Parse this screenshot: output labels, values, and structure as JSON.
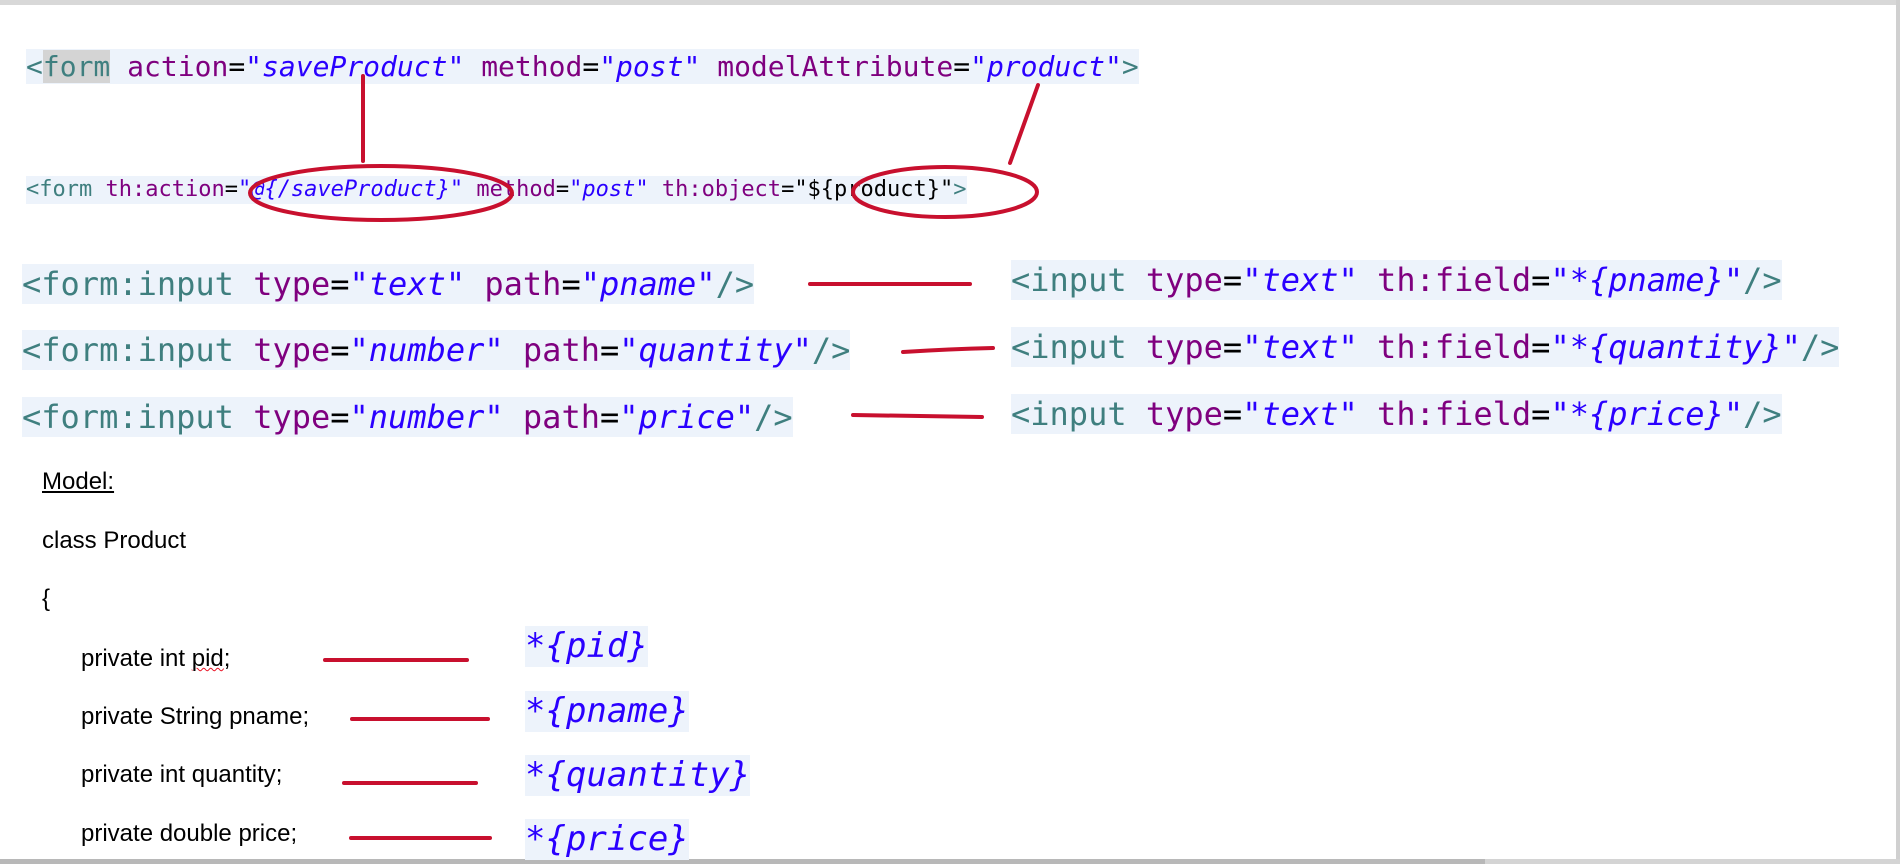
{
  "spring_form": {
    "open": "<",
    "tag": "form",
    "action_attr": "action",
    "action_value": "\"saveProduct\"",
    "method_attr": "method",
    "method_value": "\"post\"",
    "model_attr": "modelAttribute",
    "model_value": "\"product\"",
    "close": ">"
  },
  "thymeleaf_form": {
    "open": "<form",
    "action_attr": "th:action",
    "action_value": "\"@{/saveProduct}\"",
    "method_attr": "method",
    "method_value": "\"post\"",
    "object_attr": "th:object",
    "object_value": "\"${product}\"",
    "close": ">"
  },
  "spring_inputs": [
    {
      "tag": "<form:input",
      "type_attr": "type",
      "type_value": "\"text\"",
      "path_attr": "path",
      "path_value": "\"pname\"",
      "end": "/>"
    },
    {
      "tag": "<form:input",
      "type_attr": "type",
      "type_value": "\"number\"",
      "path_attr": "path",
      "path_value": "\"quantity\"",
      "end": "/>"
    },
    {
      "tag": "<form:input",
      "type_attr": "type",
      "type_value": "\"number\"",
      "path_attr": "path",
      "path_value": "\"price\"",
      "end": "/>"
    }
  ],
  "thymeleaf_inputs": [
    {
      "tag": "<input",
      "type_attr": "type",
      "type_value": "\"text\"",
      "field_attr": "th:field",
      "field_value": "\"*{pname}\"",
      "end": "/>"
    },
    {
      "tag": "<input",
      "type_attr": "type",
      "type_value": "\"text\"",
      "field_attr": "th:field",
      "field_value": "\"*{quantity}\"",
      "end": "/>"
    },
    {
      "tag": "<input",
      "type_attr": "type",
      "type_value": "\"text\"",
      "field_attr": "th:field",
      "field_value": "\"*{price}\"",
      "end": "/>"
    }
  ],
  "model": {
    "label": "Model:",
    "class_decl": "class Product",
    "open_brace": "{",
    "fields": [
      {
        "prefix": "private int ",
        "name": "pid",
        "suffix": ";"
      },
      {
        "prefix": "private String pname;",
        "name": "",
        "suffix": ""
      },
      {
        "prefix": "private int quantity;",
        "name": "",
        "suffix": ""
      },
      {
        "prefix": "private double price;",
        "name": "",
        "suffix": ""
      }
    ]
  },
  "selection_expressions": [
    "*{pid}",
    "*{pname}",
    "*{quantity}",
    "*{price}"
  ],
  "colors": {
    "tag": "#3f7f7f",
    "attribute": "#7f007f",
    "value": "#2a00ff",
    "annotation": "#c8102e",
    "code_background": "#edf3fb"
  }
}
